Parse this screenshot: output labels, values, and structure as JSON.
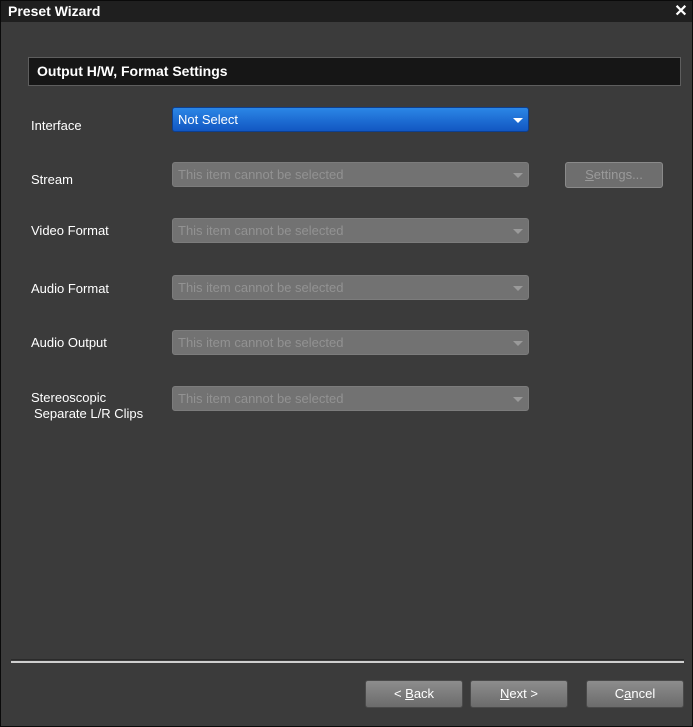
{
  "window": {
    "title": "Preset Wizard",
    "close_glyph": "✕"
  },
  "section": {
    "title": "Output H/W, Format Settings"
  },
  "fields": {
    "interface": {
      "label": "Interface",
      "value": "Not Select"
    },
    "stream": {
      "label": "Stream",
      "value": "This item cannot be selected"
    },
    "video_format": {
      "label": "Video Format",
      "value": "This item cannot be selected"
    },
    "audio_format": {
      "label": "Audio Format",
      "value": "This item cannot be selected"
    },
    "audio_output": {
      "label": "Audio Output",
      "value": "This item cannot be selected"
    },
    "stereoscopic": {
      "label_line1": "Stereoscopic",
      "label_line2": "Separate L/R Clips",
      "value": "This item cannot be selected"
    }
  },
  "settings_button": {
    "accel": "S",
    "rest": "ettings..."
  },
  "buttons": {
    "back": {
      "prefix": "< ",
      "accel": "B",
      "rest": "ack"
    },
    "next": {
      "accel": "N",
      "rest": "ext >"
    },
    "cancel": {
      "prefix": "C",
      "accel": "a",
      "rest": "ncel"
    }
  },
  "colors": {
    "window_bg": "#3b3b3b",
    "titlebar_bg": "#1f1f1f",
    "accent": "#1f6fd8",
    "disabled": "#727272"
  },
  "icons": {
    "close": "close-icon",
    "dropdown": "chevron-down-icon"
  }
}
